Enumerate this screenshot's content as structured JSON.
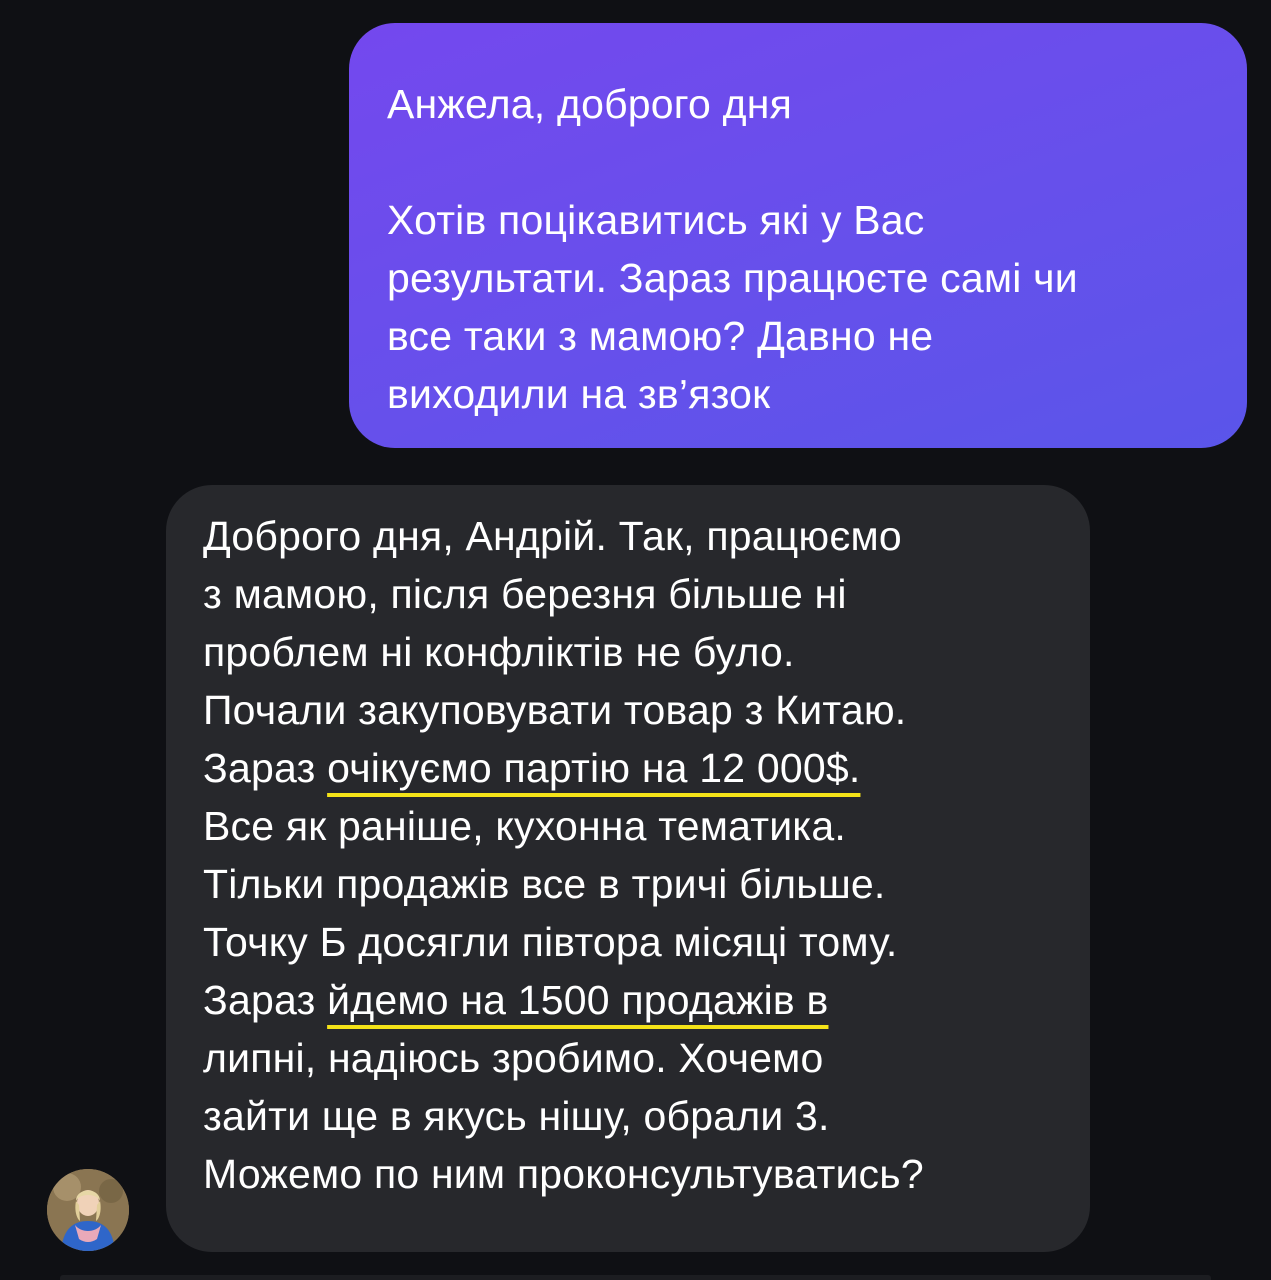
{
  "messages": {
    "outgoing": {
      "lines": [
        "Анжела, доброго дня",
        "",
        "Хотів поцікавитись які у Вас",
        "результати. Зараз працюєте самі чи",
        "все таки з мамою? Давно не",
        "виходили на зв’язок"
      ]
    },
    "incoming": {
      "lines": [
        "Доброго дня, Андрій. Так, працюємо",
        "з мамою, після березня більше ні",
        "проблем ні конфліктів не було.",
        "Почали закуповувати товар з Китаю.",
        {
          "pre": "Зараз ",
          "hl": "очікуємо партію на 12 000$."
        },
        "Все як раніше, кухонна тематика.",
        "Тільки продажів все в тричі більше.",
        "Точку Б досягли півтора місяці тому.",
        {
          "pre": "Зараз ",
          "hl": "йдемо на 1500 продажів в"
        },
        "липні, надіюсь зробимо. Хочемо",
        "зайти ще в якусь нішу, обрали 3.",
        "Можемо по ним проконсультуватись?"
      ]
    }
  },
  "colors": {
    "background": "#0f1014",
    "outgoing_bubble": "#6b4eec",
    "incoming_bubble": "#27282c",
    "highlight_underline": "#f4e318"
  },
  "icons": {
    "avatar": "contact-avatar-photo"
  }
}
